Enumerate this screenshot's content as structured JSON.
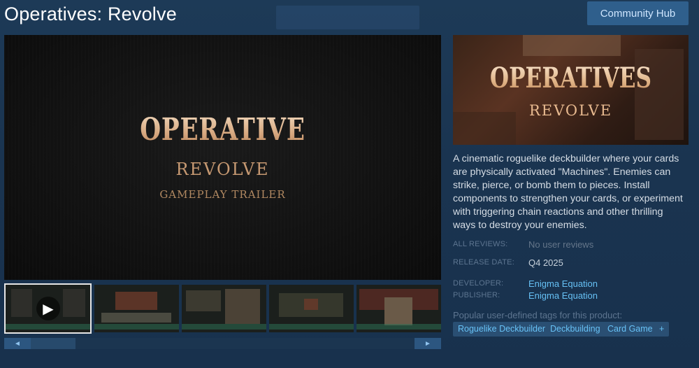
{
  "header": {
    "title": "Operatives: Revolve",
    "community_hub": "Community Hub"
  },
  "video": {
    "title_main": "OPERATIVE",
    "title_sub": "REVOLVE",
    "trailer_label": "GAMEPLAY TRAILER"
  },
  "gallery": {
    "left_arrow": "◄",
    "right_arrow": "►",
    "play_symbol": "▶",
    "thumbs": [
      "trailer",
      "screenshot-1",
      "screenshot-2",
      "screenshot-3",
      "screenshot-4"
    ]
  },
  "capsule": {
    "title_main": "OPERATIVES",
    "title_sub": "REVOLVE"
  },
  "description": "A cinematic roguelike deckbuilder where your cards are physically activated \"Machines\". Enemies can strike, pierce, or bomb them to pieces. Install components to strengthen your cards, or experiment with triggering chain reactions and other thrilling ways to destroy your enemies.",
  "meta": {
    "reviews_label": "ALL REVIEWS:",
    "reviews_value": "No user reviews",
    "release_label": "RELEASE DATE:",
    "release_value": "Q4 2025",
    "developer_label": "DEVELOPER:",
    "developer_value": "Enigma Equation",
    "publisher_label": "PUBLISHER:",
    "publisher_value": "Enigma Equation"
  },
  "tags": {
    "label": "Popular user-defined tags for this product:",
    "items": [
      "Roguelike Deckbuilder",
      "Deckbuilding",
      "Card Game",
      "+"
    ]
  },
  "colors": {
    "link": "#66c0f4",
    "tag_bg": "#2a4f73",
    "button_bg": "#2f5f8c"
  }
}
